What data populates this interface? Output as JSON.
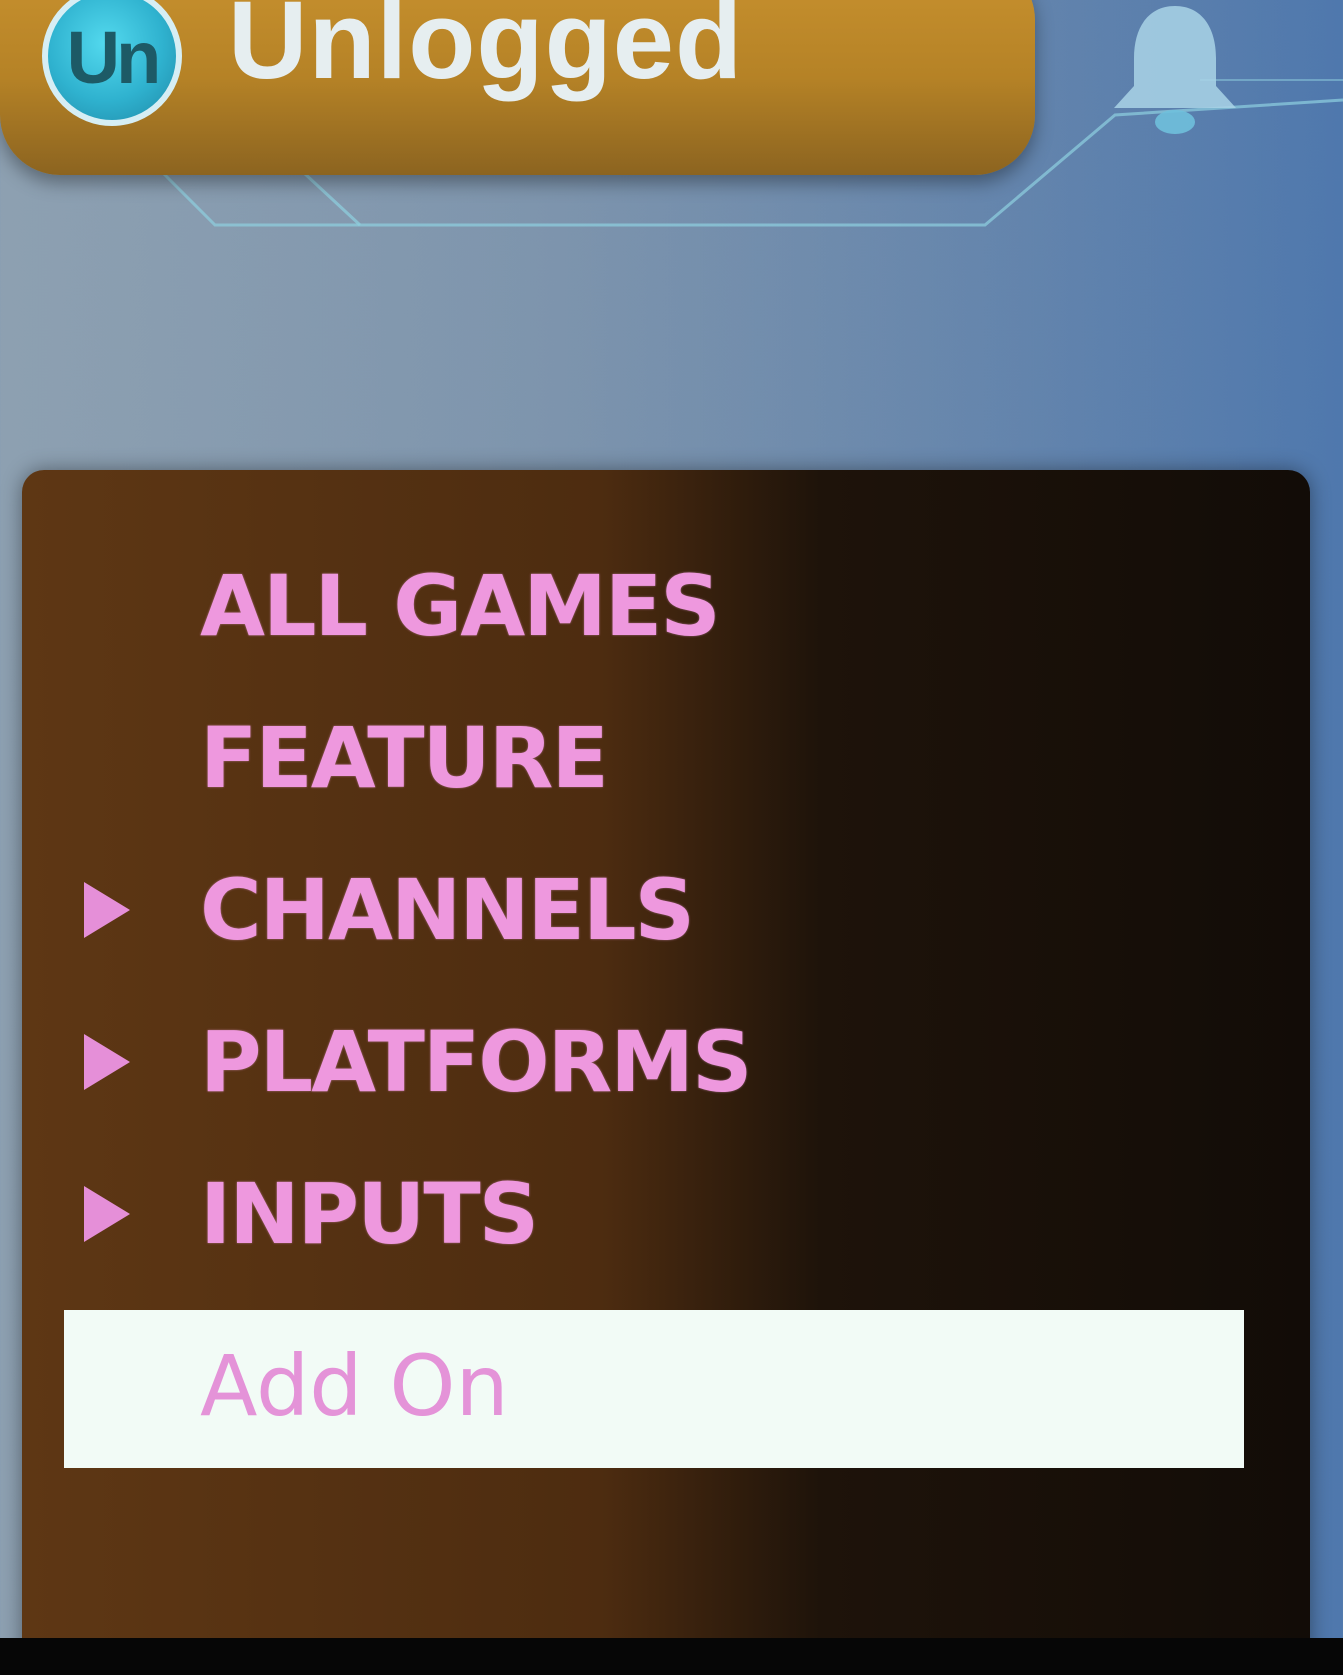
{
  "header": {
    "avatar_initials": "Un",
    "username": "Unlogged",
    "notification_icon": "bell-icon"
  },
  "menu": {
    "items": [
      {
        "label": "ALL GAMES",
        "has_submenu": false,
        "selected": false
      },
      {
        "label": "FEATURE",
        "has_submenu": false,
        "selected": false
      },
      {
        "label": "CHANNELS",
        "has_submenu": true,
        "selected": false
      },
      {
        "label": "PLATFORMS",
        "has_submenu": true,
        "selected": false
      },
      {
        "label": "INPUTS",
        "has_submenu": true,
        "selected": false
      },
      {
        "label": "Add On",
        "has_submenu": false,
        "selected": true
      }
    ]
  },
  "colors": {
    "accent_text": "#ee98de",
    "pill": "#c9922f",
    "panel": "#4d2c10",
    "selection": "#f2fbf6",
    "avatar": "#2fb2cf"
  }
}
